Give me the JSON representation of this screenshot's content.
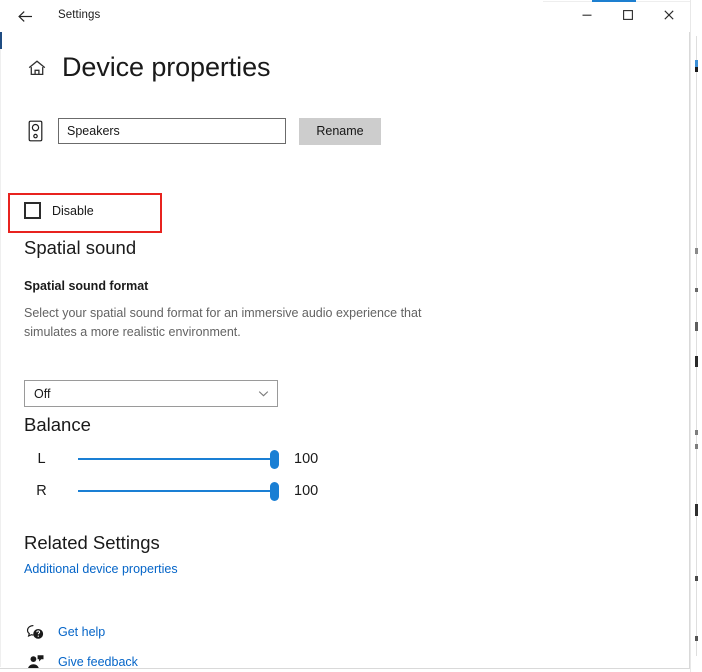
{
  "window": {
    "titlebar_label": "Settings",
    "back_icon": "back-arrow-icon",
    "minimize_icon": "minimize-icon",
    "maximize_icon": "maximize-icon",
    "close_icon": "close-icon",
    "accent_color": "#1d7fd0",
    "focus_accent_color": "#1f4c82"
  },
  "page": {
    "home_icon": "home-icon",
    "title": "Device properties"
  },
  "device": {
    "icon": "speaker-icon",
    "name_value": "Speakers",
    "name_placeholder": "Speakers",
    "rename_label": "Rename",
    "disable_label": "Disable",
    "disable_checked": false,
    "annotation_color": "#e8231f"
  },
  "spatial": {
    "heading": "Spatial sound",
    "subheading": "Spatial sound format",
    "description": "Select your spatial sound format for an immersive audio experience that simulates a more realistic environment.",
    "selected_value": "Off",
    "chevron_icon": "chevron-down-icon",
    "options": [
      "Off"
    ]
  },
  "balance": {
    "heading": "Balance",
    "slider_color": "#1a7fd4",
    "channels": [
      {
        "key": "L",
        "value": "100",
        "percent": 100
      },
      {
        "key": "R",
        "value": "100",
        "percent": 100
      }
    ]
  },
  "related": {
    "heading": "Related Settings",
    "link_label": "Additional device properties"
  },
  "footer": {
    "items": [
      {
        "icon": "help-bubble-icon",
        "label": "Get help"
      },
      {
        "icon": "feedback-person-icon",
        "label": "Give feedback"
      }
    ]
  }
}
